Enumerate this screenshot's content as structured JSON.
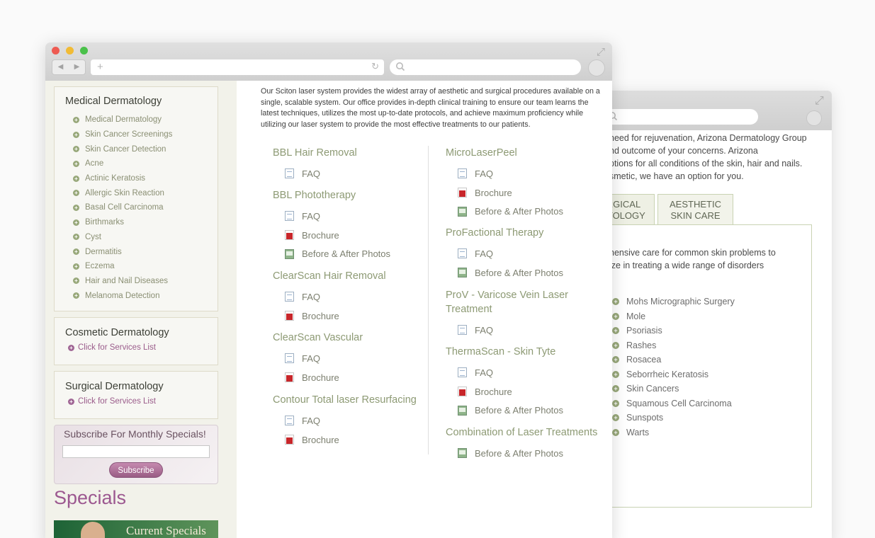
{
  "back_window": {
    "intro_text": "need for rejuvenation, Arizona Dermatology Group\nnd outcome of your concerns. Arizona\nptions for all conditions of the skin, hair and nails.\nsmetic, we have an option for you.",
    "tabs": [
      {
        "label": "RGICAL\nATOLOGY"
      },
      {
        "label": "AESTHETIC\nSKIN CARE"
      }
    ],
    "panel_text": "hensive care for common skin problems to\nize in treating a wide range of disorders",
    "list": [
      "Mohs Micrographic Surgery",
      "Mole",
      "Psoriasis",
      "Rashes",
      "Rosacea",
      "Seborrheic Keratosis",
      "Skin Cancers",
      "Squamous Cell Carcinoma",
      "Sunspots",
      "Warts"
    ]
  },
  "browser": {
    "nav_back": "◀",
    "nav_forward": "▶",
    "url_plus": "+",
    "reload_icon": "↻",
    "expand_icon": "⤢"
  },
  "sidebar": {
    "medical": {
      "title": "Medical Dermatology",
      "items": [
        "Medical Dermatology",
        "Skin Cancer Screenings",
        "Skin Cancer Detection",
        "Acne",
        "Actinic Keratosis",
        "Allergic Skin Reaction",
        "Basal Cell Carcinoma",
        "Birthmarks",
        "Cyst",
        "Dermatitis",
        "Eczema",
        "Hair and Nail Diseases",
        "Melanoma Detection"
      ]
    },
    "cosmetic": {
      "title": "Cosmetic Dermatology",
      "link": "Click for Services List"
    },
    "surgical": {
      "title": "Surgical Dermatology",
      "link": "Click for Services List"
    },
    "subscribe": {
      "title": "Subscribe For Monthly Specials!",
      "input_value": "",
      "button": "Subscribe"
    },
    "specials": {
      "title": "Specials",
      "banner_text": "Current Specials"
    }
  },
  "main": {
    "intro": "Our Sciton laser system provides the widest array of aesthetic and surgical procedures available on a single, scalable system. Our office provides in-depth clinical training to ensure our team learns the latest techniques, utilizes the most up-to-date protocols, and achieve maximum proficiency while utilizing our laser system to provide the most effective treatments to our patients.",
    "left_column": [
      {
        "title": "BBL Hair Removal",
        "links": [
          {
            "type": "faq",
            "label": "FAQ"
          }
        ]
      },
      {
        "title": "BBL Phototherapy",
        "links": [
          {
            "type": "faq",
            "label": "FAQ"
          },
          {
            "type": "pdf",
            "label": "Brochure"
          },
          {
            "type": "photo",
            "label": "Before & After Photos"
          }
        ]
      },
      {
        "title": "ClearScan Hair Removal",
        "links": [
          {
            "type": "faq",
            "label": "FAQ"
          },
          {
            "type": "pdf",
            "label": "Brochure"
          }
        ]
      },
      {
        "title": "ClearScan Vascular",
        "links": [
          {
            "type": "faq",
            "label": "FAQ"
          },
          {
            "type": "pdf",
            "label": "Brochure"
          }
        ]
      },
      {
        "title": "Contour Total laser Resurfacing",
        "links": [
          {
            "type": "faq",
            "label": "FAQ"
          },
          {
            "type": "pdf",
            "label": "Brochure"
          }
        ]
      }
    ],
    "right_column": [
      {
        "title": "MicroLaserPeel",
        "links": [
          {
            "type": "faq",
            "label": "FAQ"
          },
          {
            "type": "pdf",
            "label": "Brochure"
          },
          {
            "type": "photo",
            "label": "Before & After Photos"
          }
        ]
      },
      {
        "title": "ProFactional Therapy",
        "links": [
          {
            "type": "faq",
            "label": "FAQ"
          },
          {
            "type": "photo",
            "label": "Before & After Photos"
          }
        ]
      },
      {
        "title": "ProV - Varicose Vein Laser Treatment",
        "links": [
          {
            "type": "faq",
            "label": "FAQ"
          }
        ]
      },
      {
        "title": "ThermaScan - Skin Tyte",
        "links": [
          {
            "type": "faq",
            "label": "FAQ"
          },
          {
            "type": "pdf",
            "label": "Brochure"
          },
          {
            "type": "photo",
            "label": "Before & After Photos"
          }
        ]
      },
      {
        "title": "Combination of Laser Treatments",
        "links": [
          {
            "type": "photo",
            "label": "Before & After Photos"
          }
        ]
      }
    ]
  },
  "colors": {
    "accent_green": "#8d9a74",
    "accent_purple": "#9c5890",
    "pdf_red": "#c8262a"
  }
}
